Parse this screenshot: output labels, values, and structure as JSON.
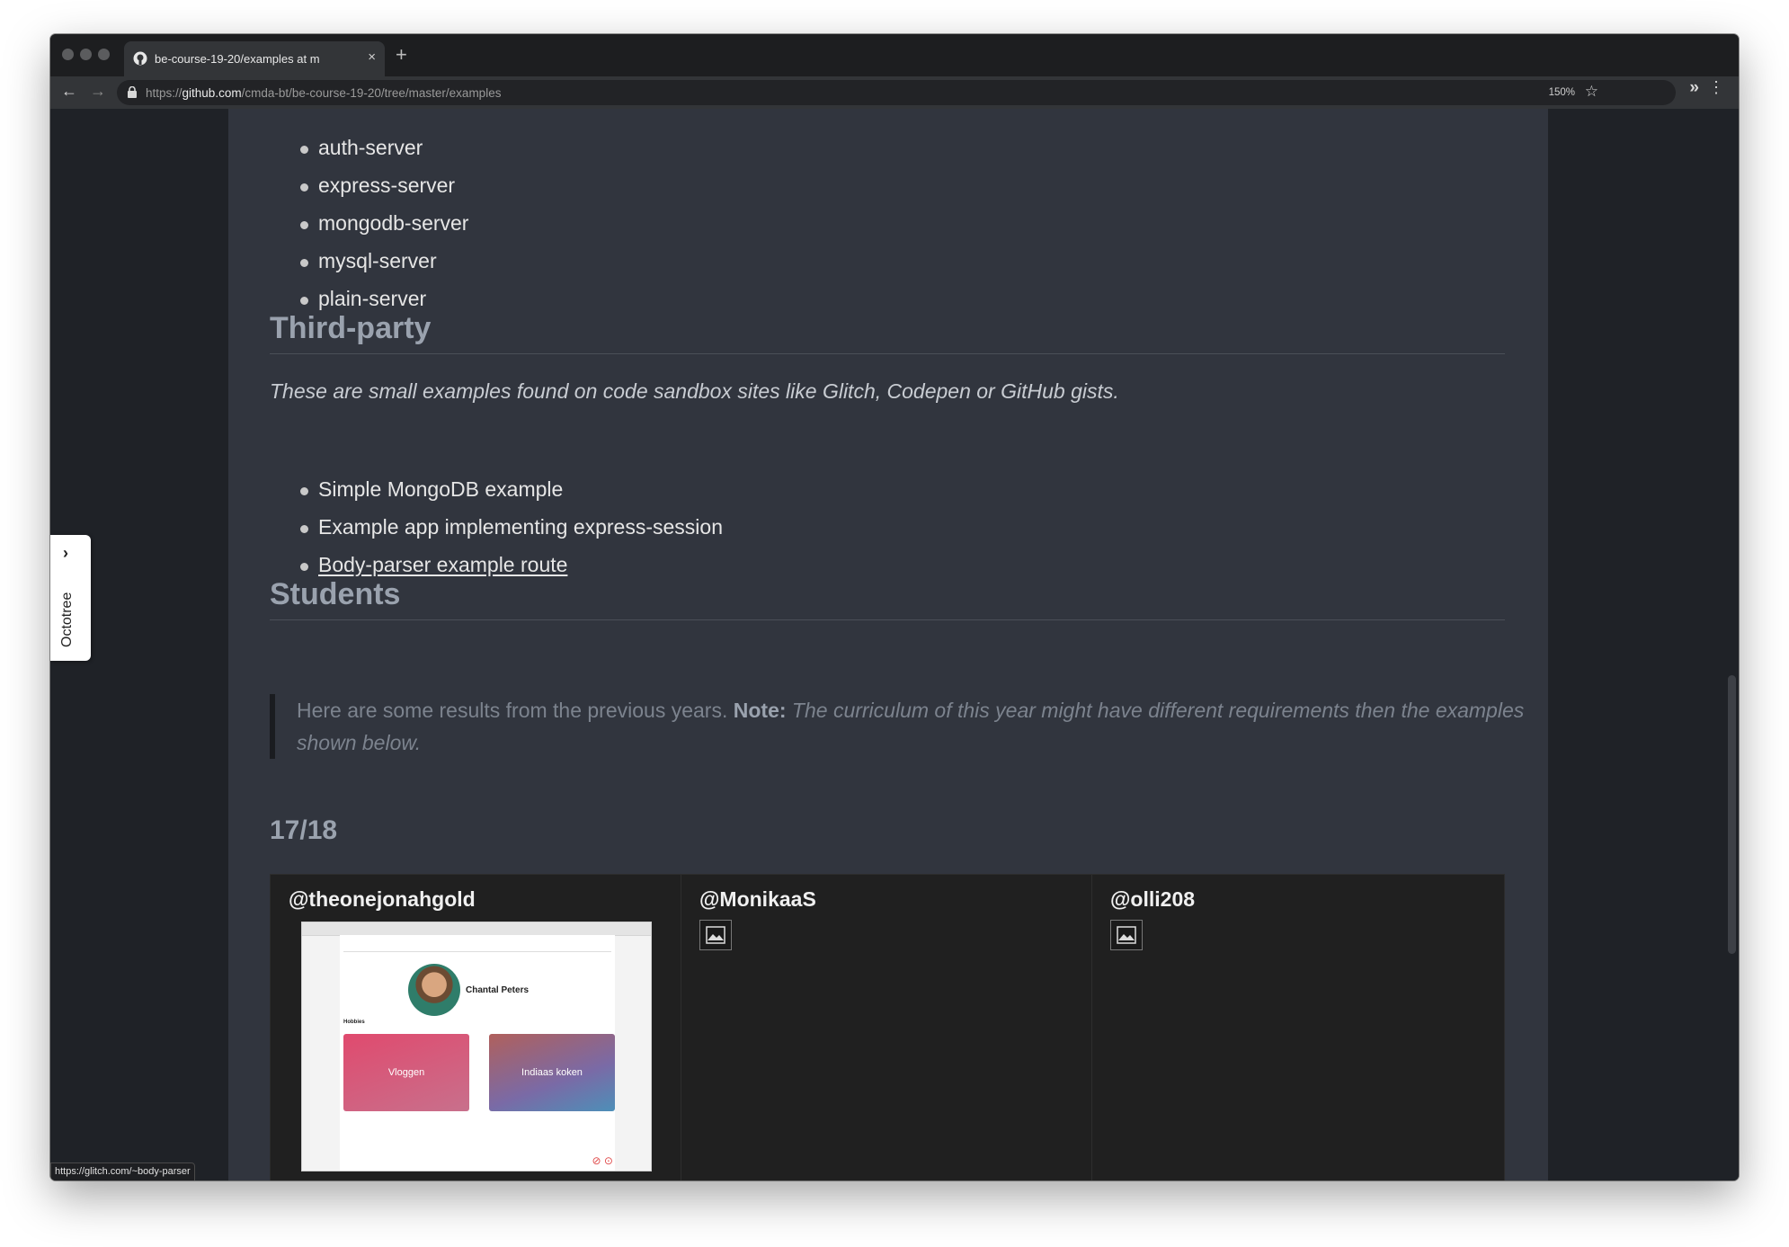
{
  "browser": {
    "tab_title": "be-course-19-20/examples at m",
    "tab_close": "×",
    "new_tab": "+",
    "url_prefix": "https://",
    "url_host": "github.com",
    "url_path": "/cmda-bt/be-course-19-20/tree/master/examples",
    "zoom": "150%",
    "back_icon": "←",
    "forward_icon": "→",
    "star_icon": "☆",
    "extensions_icon": "»",
    "menu_icon": "⋮"
  },
  "servers": {
    "items": [
      "auth-server",
      "express-server",
      "mongodb-server",
      "mysql-server",
      "plain-server"
    ]
  },
  "third_party": {
    "heading": "Third-party",
    "intro": "These are small examples found on code sandbox sites like Glitch, Codepen or GitHub gists.",
    "items": [
      "Simple MongoDB example",
      "Example app implementing express-session"
    ],
    "link": "Body-parser example route"
  },
  "students": {
    "heading": "Students",
    "quote_text": "Here are some results from the previous years. ",
    "note_label": "Note:",
    "note_text": " The curriculum of this year might have different requirements then the examples shown below.",
    "year": "17/18",
    "table": [
      {
        "user": "@theonejonahgold",
        "thumb_name": "Chantal Peters",
        "thumb_hobbies": "Hobbies",
        "card1": "Vloggen",
        "card2": "Indiaas koken"
      },
      {
        "user": "@MonikaaS"
      },
      {
        "user": "@olli208"
      }
    ]
  },
  "octotree": {
    "label": "Octotree",
    "chevron": "›"
  },
  "status_url": "https://glitch.com/~body-parser"
}
